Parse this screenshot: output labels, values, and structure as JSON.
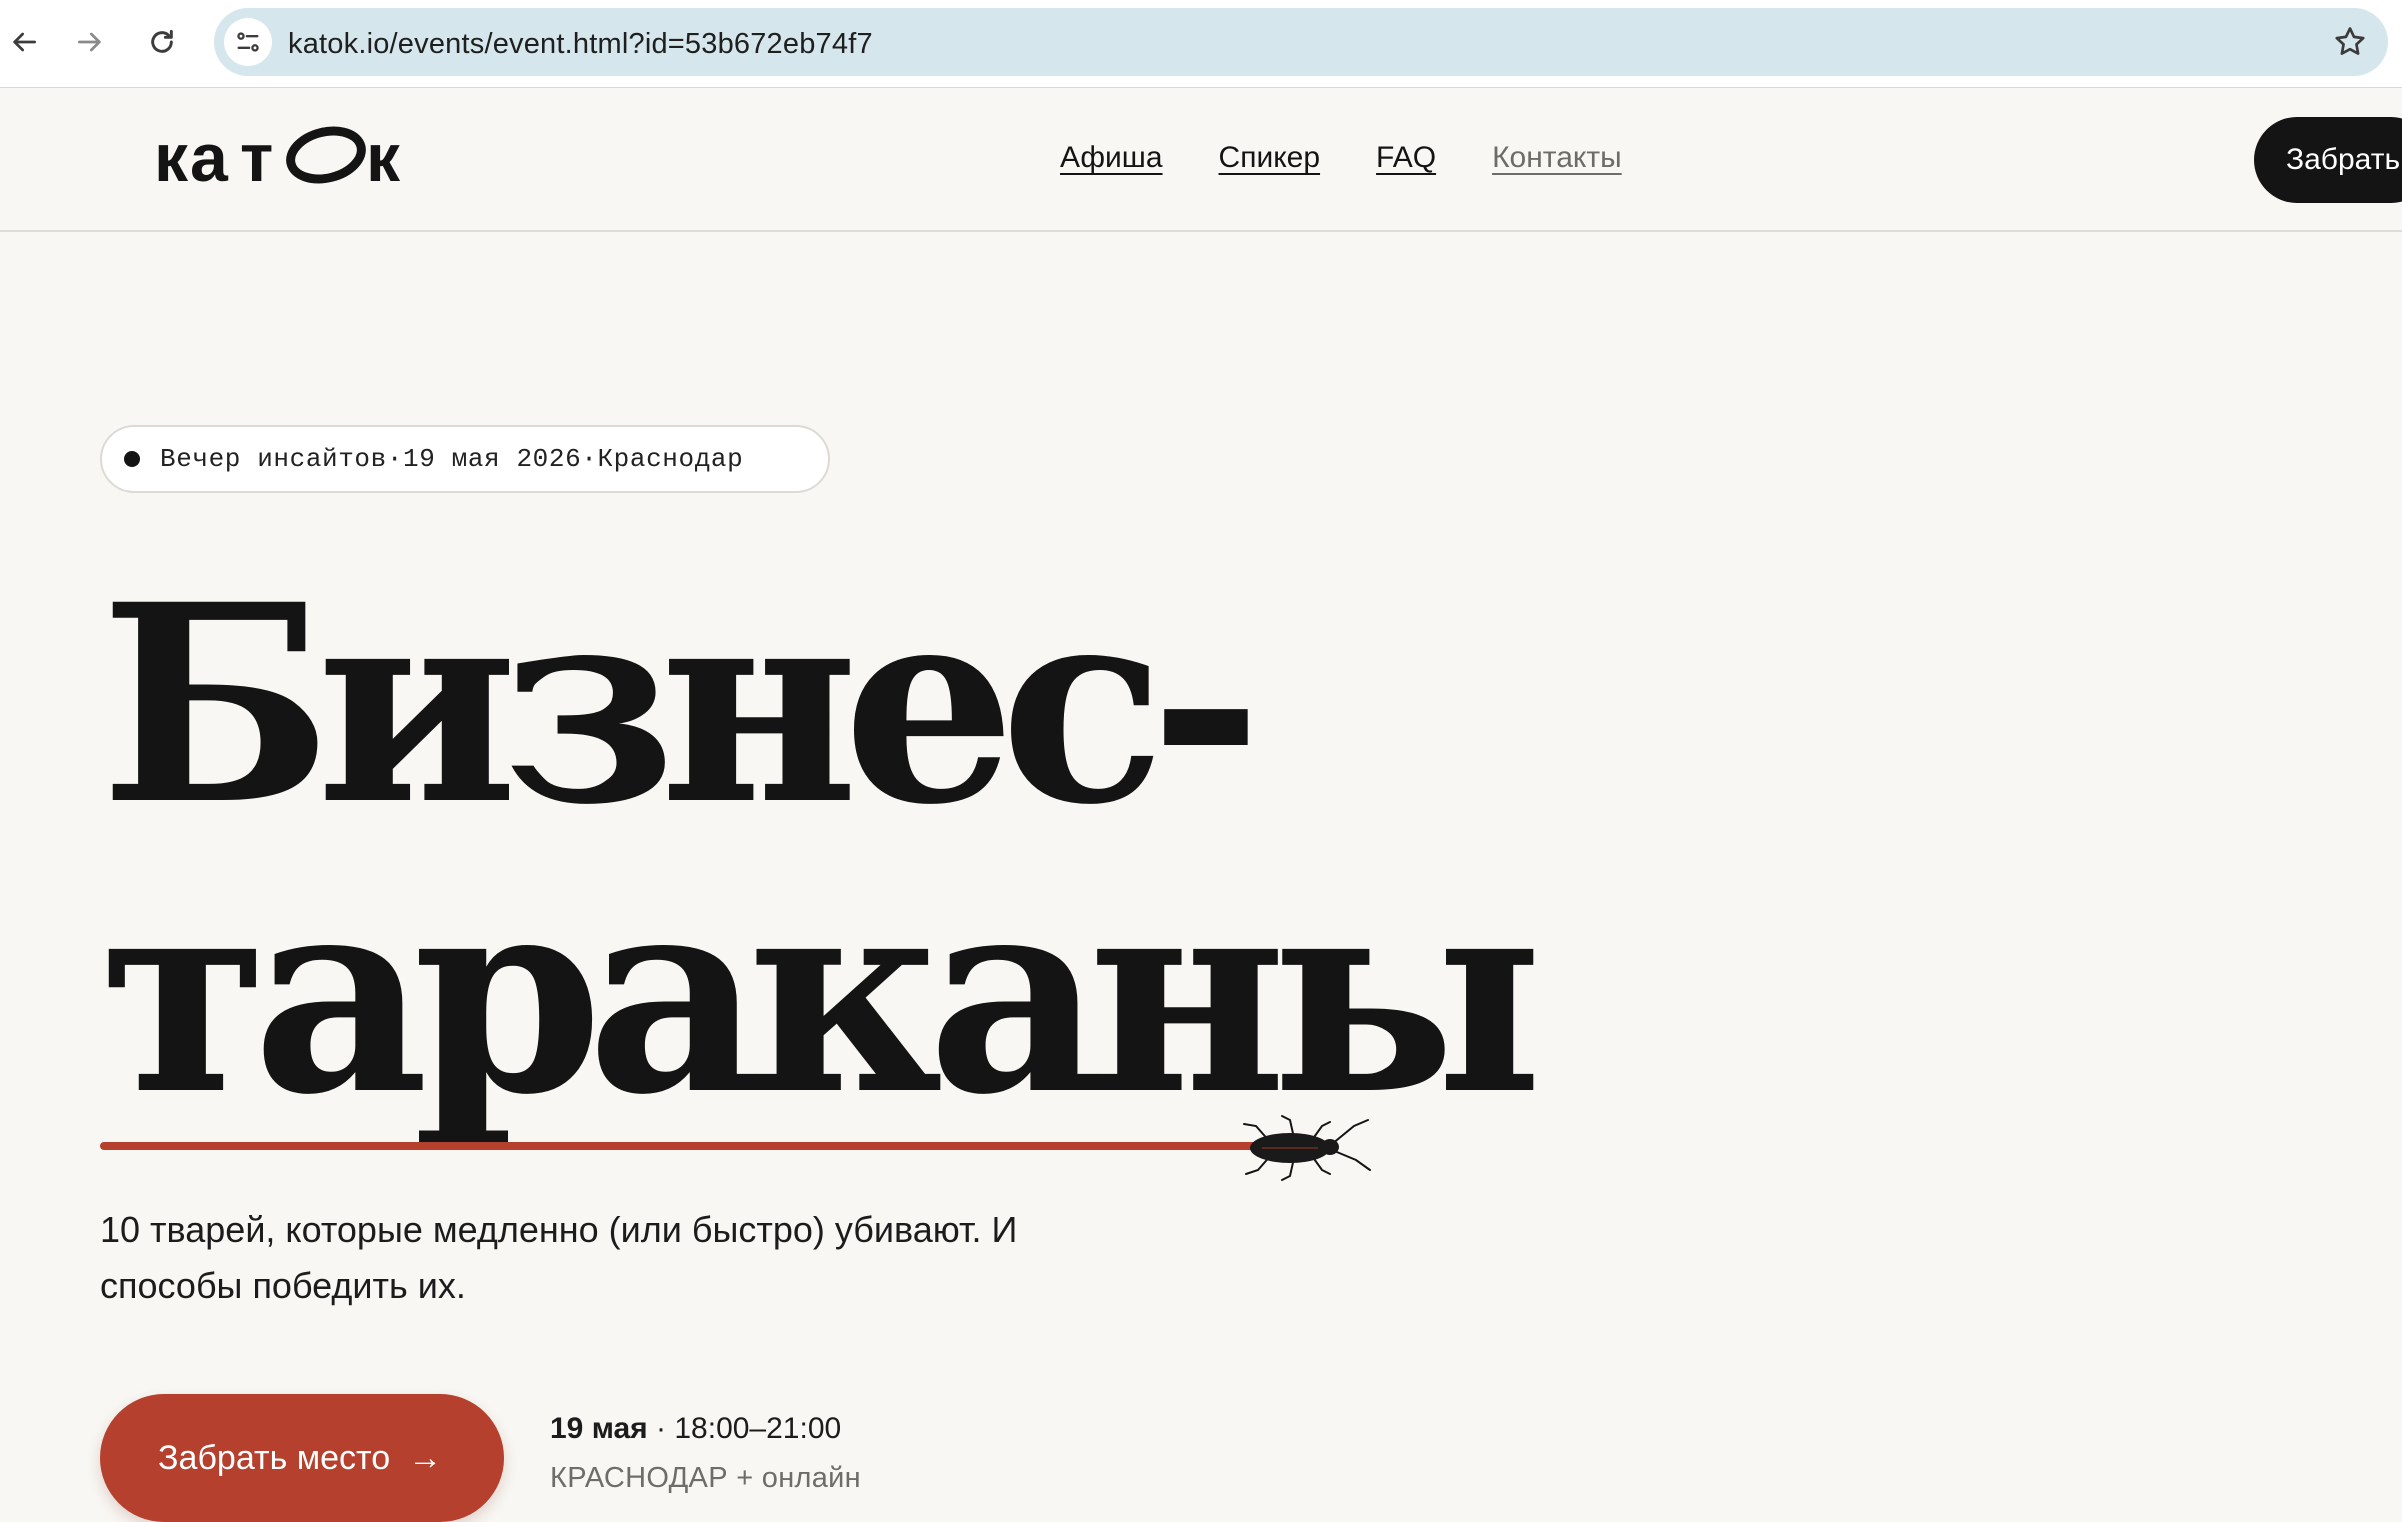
{
  "browser": {
    "url": "katok.io/events/event.html?id=53b672eb74f7",
    "icons": [
      "back-arrow-icon",
      "forward-arrow-icon",
      "reload-icon",
      "site-settings-icon",
      "bookmark-star-icon"
    ]
  },
  "header": {
    "logo_text": "катОк",
    "nav": [
      {
        "label": "Афиша"
      },
      {
        "label": "Спикер"
      },
      {
        "label": "FAQ"
      },
      {
        "label": "Контакты"
      }
    ],
    "cta_label": "Забрать"
  },
  "hero": {
    "chip": {
      "event_type": "Вечер инсайтов",
      "separator": " · ",
      "date": "19 мая 2026",
      "city": "Краснодар"
    },
    "title_line_1": "Бизнес-",
    "title_line_2": "тараканы",
    "subtitle": "10 тварей, которые медленно (или быстро) убивают. И способы победить их.",
    "cta_label": "Забрать место",
    "cta_arrow": "→",
    "date_bold": "19 мая",
    "time": " · 18:00–21:00",
    "location": "КРАСНОДАР + онлайн",
    "decoration_icon": "cockroach-icon"
  },
  "colors": {
    "accent": "#b5402d",
    "background": "#f8f7f3",
    "text": "#141414",
    "omnibox": "#d5e6ec"
  }
}
